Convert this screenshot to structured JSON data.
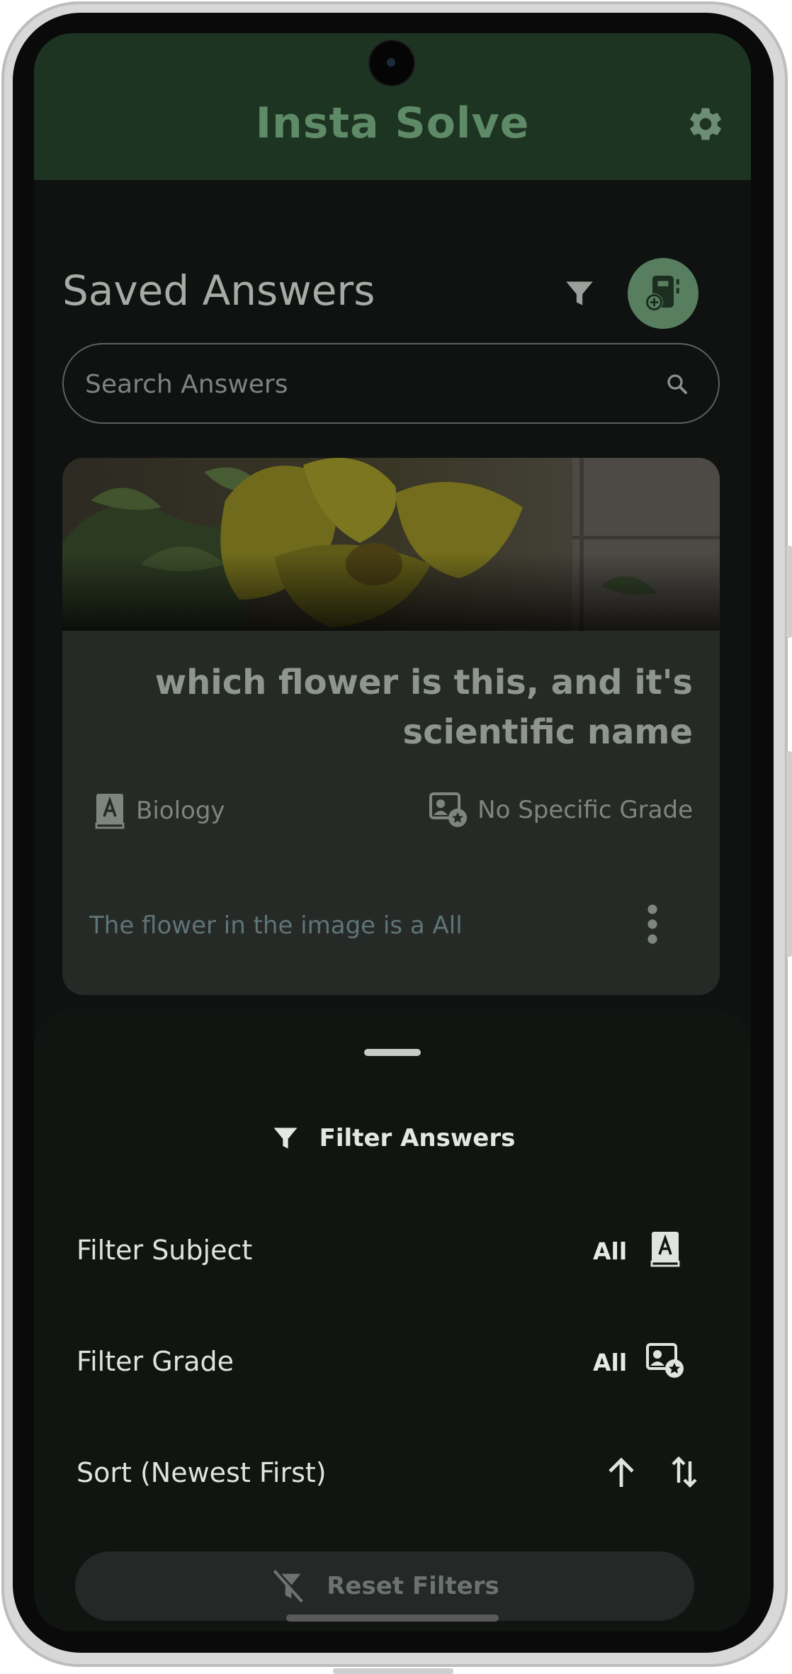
{
  "app_bar": {
    "title": "Insta Solve",
    "settings_icon": "gear-icon",
    "color": "#1e3423"
  },
  "main": {
    "heading": "Saved Answers",
    "filter_icon": "filter-icon",
    "add_button_icon": "add-note-icon",
    "search": {
      "placeholder": "Search Answers",
      "value": ""
    },
    "answer_card": {
      "image": "yellow-flower-photo",
      "question": "which flower is this, and it's scientific name",
      "subject": "Biology",
      "grade": "No Specific Grade",
      "preview": "The flower in the image is a All",
      "more_icon": "more-vertical-icon"
    }
  },
  "filter_sheet": {
    "title": "Filter Answers",
    "rows": [
      {
        "label": "Filter Subject",
        "value": "All",
        "icon": "subject-book-icon"
      },
      {
        "label": "Filter Grade",
        "value": "All",
        "icon": "grade-badge-icon"
      },
      {
        "label": "Sort (Newest First)",
        "value": "",
        "icon": "sort-icon"
      }
    ],
    "reset_label": "Reset Filters"
  }
}
